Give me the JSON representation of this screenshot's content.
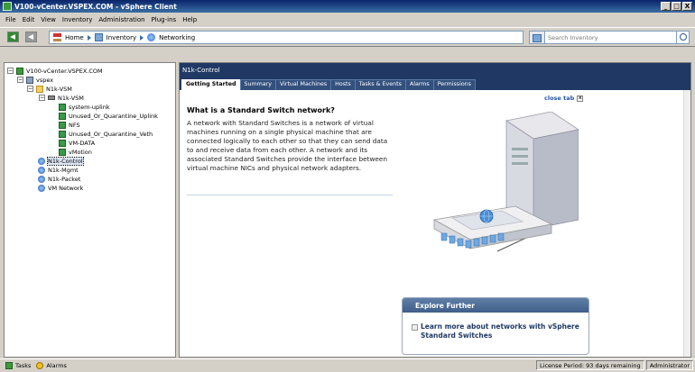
{
  "window": {
    "title": "V100-vCenter.VSPEX.COM - vSphere Client",
    "controls": [
      "_",
      "□",
      "X"
    ]
  },
  "menu": [
    "File",
    "Edit",
    "View",
    "Inventory",
    "Administration",
    "Plug-ins",
    "Help"
  ],
  "nav": {
    "breadcrumbs": [
      "Home",
      "Inventory",
      "Networking"
    ],
    "search_placeholder": "Search Inventory"
  },
  "tree": {
    "nodes": [
      {
        "label": "V100-vCenter.VSPEX.COM",
        "icon": "vcenter-icon",
        "expander": "−"
      },
      {
        "label": "vspex",
        "icon": "datacenter-icon",
        "expander": "−"
      },
      {
        "label": "N1k-VSM",
        "icon": "folder-icon",
        "expander": "−"
      },
      {
        "label": "N1k-VSM",
        "icon": "dvswitch-icon",
        "expander": "−"
      },
      {
        "label": "system-uplink",
        "icon": "portgroup-icon"
      },
      {
        "label": "Unused_Or_Quarantine_Uplink",
        "icon": "portgroup-icon"
      },
      {
        "label": "NFS",
        "icon": "portgroup-icon"
      },
      {
        "label": "Unused_Or_Quarantine_Veth",
        "icon": "portgroup-icon"
      },
      {
        "label": "VM-DATA",
        "icon": "portgroup-icon"
      },
      {
        "label": "vMotion",
        "icon": "portgroup-icon"
      },
      {
        "label": "N1k-Control",
        "icon": "network-icon",
        "selected": true
      },
      {
        "label": "N1k-Mgmt",
        "icon": "network-icon"
      },
      {
        "label": "N1k-Packet",
        "icon": "network-icon"
      },
      {
        "label": "VM Network",
        "icon": "network-icon"
      }
    ]
  },
  "object": {
    "name": "N1k-Control",
    "tabs": [
      "Getting Started",
      "Summary",
      "Virtual Machines",
      "Hosts",
      "Tasks & Events",
      "Alarms",
      "Permissions"
    ],
    "active_tab": "Getting Started"
  },
  "getting_started": {
    "close_tab": "close tab",
    "close_x": "x",
    "heading": "What is a Standard Switch network?",
    "body": "A network with Standard Switches is a network of virtual machines running on a single physical machine that are connected logically to each other so that they can send data to and receive data from each other. A network and its associated Standard Switches provide the interface between virtual machine NICs and physical network adapters.",
    "explore": {
      "title": "Explore Further",
      "link": "Learn more about networks with vSphere Standard Switches"
    }
  },
  "statusbar": {
    "tasks": "Tasks",
    "alarms": "Alarms",
    "license": "License Period: 93 days remaining",
    "user": "Administrator"
  }
}
